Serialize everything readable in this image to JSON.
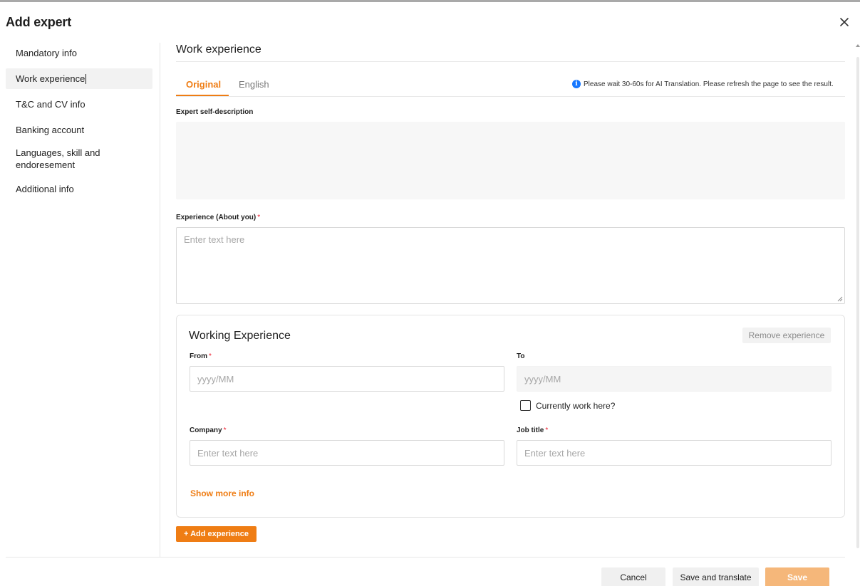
{
  "modal": {
    "title": "Add expert"
  },
  "sidebar": {
    "items": [
      {
        "label": "Mandatory info"
      },
      {
        "label": "Work experience"
      },
      {
        "label": "T&C and CV info"
      },
      {
        "label": "Banking account"
      },
      {
        "label": "Languages, skill and endoresement"
      },
      {
        "label": "Additional info"
      }
    ],
    "active_index": 1
  },
  "main": {
    "section_title": "Work experience",
    "tabs": [
      {
        "label": "Original"
      },
      {
        "label": "English"
      }
    ],
    "active_tab": "Original",
    "notice": {
      "icon": "info-icon",
      "text": "Please wait 30-60s for AI Translation. Please refresh the page to see the result."
    },
    "self_description": {
      "label": "Expert self-description",
      "value": ""
    },
    "experience_about": {
      "label": "Experience (About you)",
      "placeholder": "Enter text here",
      "required": "*"
    },
    "working_experience": {
      "title": "Working Experience",
      "remove_label": "Remove experience",
      "from": {
        "label": "From",
        "placeholder": "yyyy/MM",
        "required": "*"
      },
      "to": {
        "label": "To",
        "placeholder": "yyyy/MM"
      },
      "currently": {
        "label": "Currently work here?"
      },
      "company": {
        "label": "Company",
        "placeholder": "Enter text here",
        "required": "*"
      },
      "job_title": {
        "label": "Job title",
        "placeholder": "Enter text here",
        "required": "*"
      },
      "show_more": "Show more info"
    },
    "add_experience_label": "+ Add experience"
  },
  "footer": {
    "cancel": "Cancel",
    "save_translate": "Save and translate",
    "save": "Save"
  },
  "colors": {
    "accent": "#ef7d14",
    "info": "#1677ff",
    "required": "#ee2233"
  }
}
